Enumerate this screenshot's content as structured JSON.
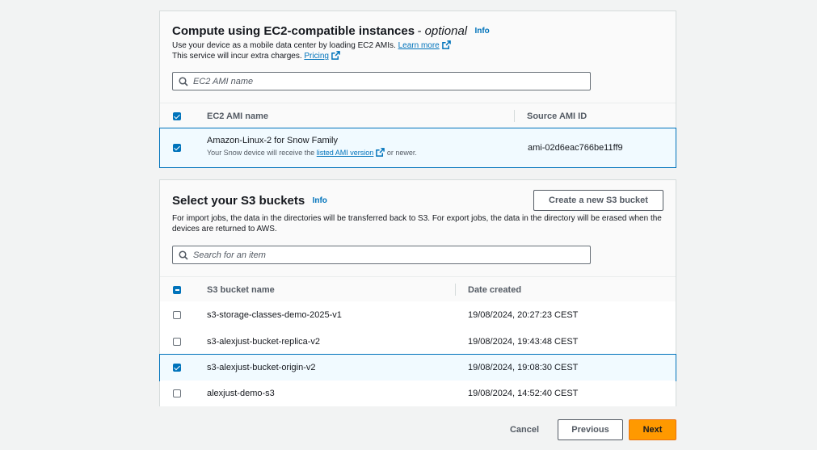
{
  "ec2": {
    "title": "Compute using EC2-compatible instances",
    "title_suffix": "- optional",
    "info": "Info",
    "desc1": "Use your device as a mobile data center by loading EC2 AMIs.",
    "learn_more": "Learn more",
    "desc2": "This service will incur extra charges.",
    "pricing": "Pricing",
    "search_placeholder": "EC2 AMI name",
    "columns": [
      "EC2 AMI name",
      "Source AMI ID"
    ],
    "header_checkbox": "checked",
    "rows": [
      {
        "name": "Amazon-Linux-2 for Snow Family",
        "note_prefix": "Your Snow device will receive the",
        "note_link": "listed AMI version",
        "note_suffix": "or newer.",
        "ami_id": "ami-02d6eac766be11ff9",
        "checked": true
      }
    ]
  },
  "s3": {
    "title": "Select your S3 buckets",
    "info": "Info",
    "create_button": "Create a new S3 bucket",
    "desc": "For import jobs, the data in the directories will be transferred back to S3. For export jobs, the data in the directory will be erased when the devices are returned to AWS.",
    "search_placeholder": "Search for an item",
    "columns": [
      "S3 bucket name",
      "Date created"
    ],
    "header_checkbox": "indeterminate",
    "rows": [
      {
        "name": "s3-storage-classes-demo-2025-v1",
        "date": "19/08/2024, 20:27:23 CEST",
        "checked": false
      },
      {
        "name": "s3-alexjust-bucket-replica-v2",
        "date": "19/08/2024, 19:43:48 CEST",
        "checked": false
      },
      {
        "name": "s3-alexjust-bucket-origin-v2",
        "date": "19/08/2024, 19:08:30 CEST",
        "checked": true
      },
      {
        "name": "alexjust-demo-s3",
        "date": "19/08/2024, 14:52:40 CEST",
        "checked": false
      }
    ]
  },
  "footer": {
    "cancel": "Cancel",
    "previous": "Previous",
    "next": "Next"
  },
  "colors": {
    "accent": "#0073bb",
    "primary_button": "#ff9900",
    "background": "#f2f3f3"
  }
}
